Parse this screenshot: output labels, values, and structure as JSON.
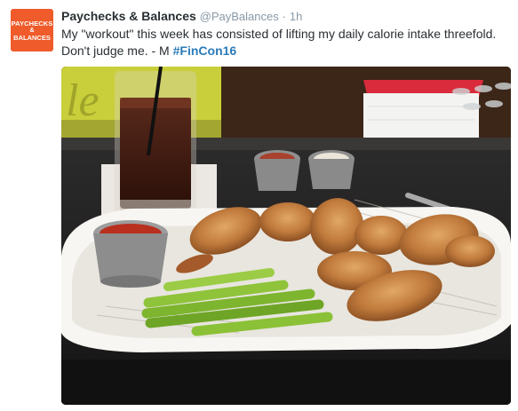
{
  "tweet": {
    "avatar": {
      "line1": "PAYCHECKS",
      "line2": "&",
      "line3": "BALANCES",
      "bg": "#ef5b2a"
    },
    "display_name": "Paychecks & Balances",
    "handle": "@PayBalances",
    "separator": "·",
    "time": "1h",
    "text_before_hashtag": "My \"workout\" this week has consisted of lifting my daily calorie intake threefold. Don't judge me. - M ",
    "hashtag": "#FinCon16",
    "colors": {
      "name": "#292f33",
      "meta": "#8899a6",
      "hashtag": "#2b7bb9"
    },
    "photo": {
      "icon": "photo-wings-celery"
    }
  }
}
